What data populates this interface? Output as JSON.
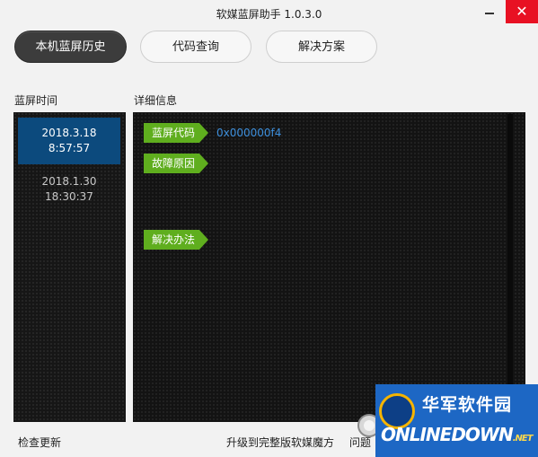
{
  "app": {
    "title": "软媒蓝屏助手 1.0.3.0",
    "close_glyph": "✕"
  },
  "tabs": [
    {
      "label": "本机蓝屏历史",
      "active": true
    },
    {
      "label": "代码查询",
      "active": false
    },
    {
      "label": "解决方案",
      "active": false
    }
  ],
  "sidebar": {
    "heading": "蓝屏时间",
    "records": [
      {
        "date": "2018.3.18",
        "time": "8:57:57",
        "selected": true
      },
      {
        "date": "2018.1.30",
        "time": "18:30:37",
        "selected": false
      }
    ]
  },
  "detail": {
    "heading": "详细信息",
    "code_label": "蓝屏代码",
    "code_value": "0x000000f4",
    "cause_label": "故障原因",
    "cause_value": "",
    "solution_label": "解决办法",
    "solution_value": ""
  },
  "footer": {
    "check_update": "检查更新",
    "upgrade": "升级到完整版软媒魔方",
    "feedback": "问题"
  },
  "watermark": {
    "cn": "华军软件园",
    "en": "ONLINEDOWN",
    "suffix": ".NET"
  },
  "colors": {
    "accent_tag": "#5fae1e",
    "selected_record": "#0c4a7d",
    "code_value": "#3d8fdc",
    "close_button": "#e81123"
  }
}
